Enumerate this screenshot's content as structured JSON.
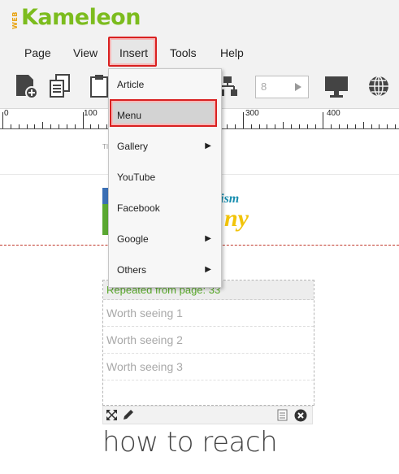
{
  "logo": {
    "prefix": "WEB",
    "name": "Kameleon"
  },
  "menubar": {
    "page": "Page",
    "view": "View",
    "insert": "Insert",
    "tools": "Tools",
    "help": "Help"
  },
  "toolbar": {
    "page_input_value": "8"
  },
  "ruler": {
    "labels": [
      "0",
      "100",
      "300",
      "400"
    ]
  },
  "dropdown": {
    "items": [
      {
        "label": "Article",
        "submenu": false
      },
      {
        "label": "Menu",
        "submenu": false
      },
      {
        "label": "Gallery",
        "submenu": true
      },
      {
        "label": "YouTube",
        "submenu": false
      },
      {
        "label": "Facebook",
        "submenu": false
      },
      {
        "label": "Google",
        "submenu": true
      },
      {
        "label": "Others",
        "submenu": true
      }
    ],
    "highlighted": "Menu"
  },
  "banner": {
    "text1": "urism",
    "text2": "ny"
  },
  "repeated_block": {
    "header": "Repeated from page: 33",
    "items": [
      "Worth seeing 1",
      "Worth seeing 2",
      "Worth seeing 3"
    ]
  },
  "heading": "how to reach",
  "colors": {
    "accent_green": "#7cbc1e",
    "highlight_red": "#d92020",
    "repeat_text": "#59a92a"
  }
}
